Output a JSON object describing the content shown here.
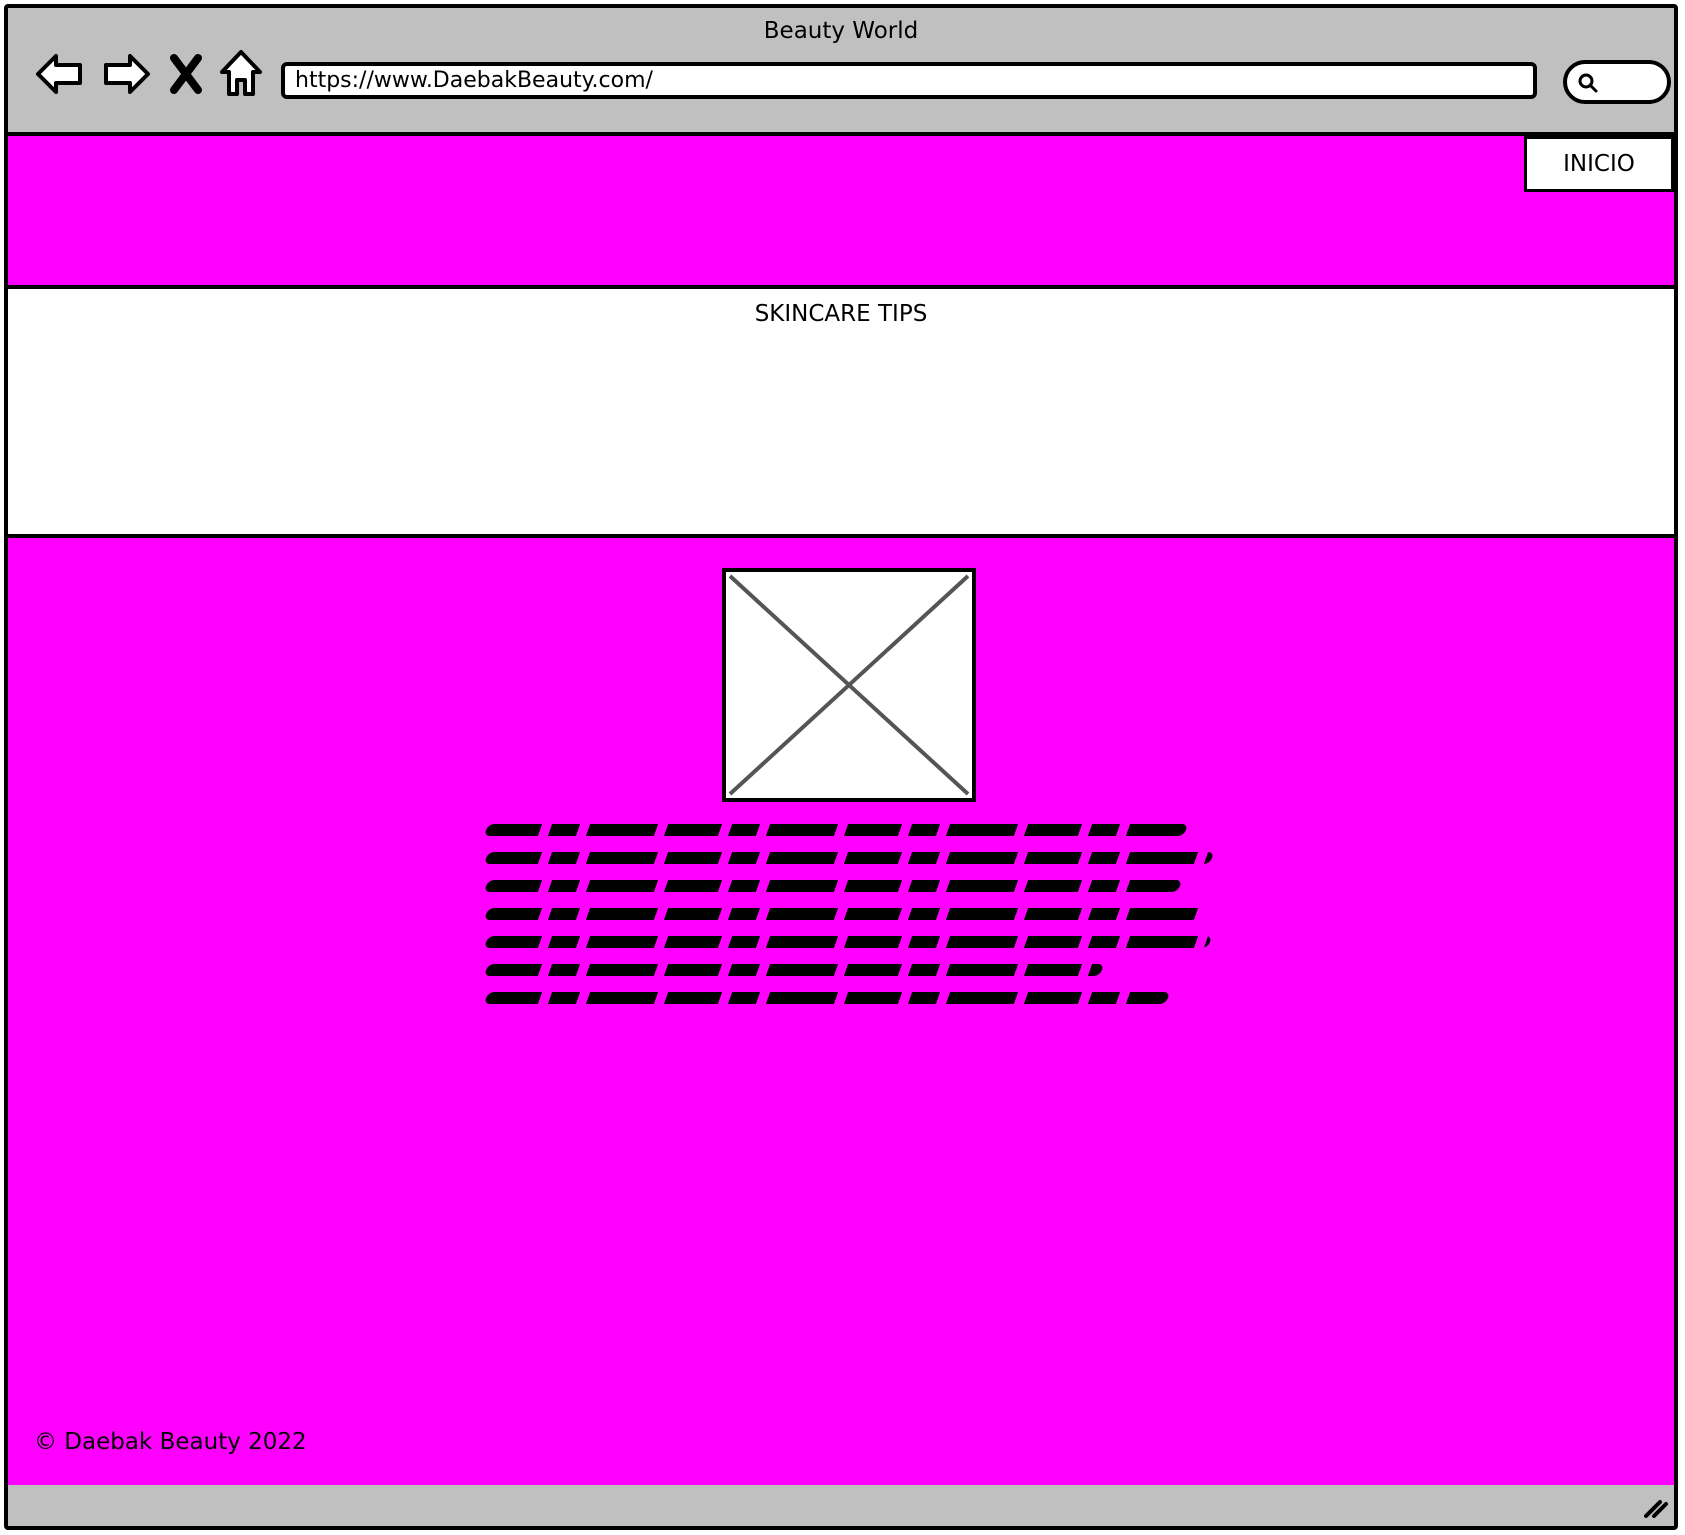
{
  "window": {
    "title": "Beauty World"
  },
  "toolbar": {
    "back_icon": "back-arrow-icon",
    "forward_icon": "forward-arrow-icon",
    "stop_icon": "close-icon",
    "home_icon": "home-icon",
    "url": "https://www.DaebakBeauty.com/",
    "search_icon": "search-icon"
  },
  "header": {
    "nav_button": "INICIO",
    "background_color": "#ff00ff"
  },
  "tips": {
    "title": "SKINCARE TIPS"
  },
  "content": {
    "image_icon": "image-placeholder-icon",
    "body_text_lines": 7
  },
  "footer": {
    "copyright": "© Daebak Beauty 2022"
  },
  "colors": {
    "accent": "#ff00ff",
    "chrome": "#c0c0c0"
  }
}
